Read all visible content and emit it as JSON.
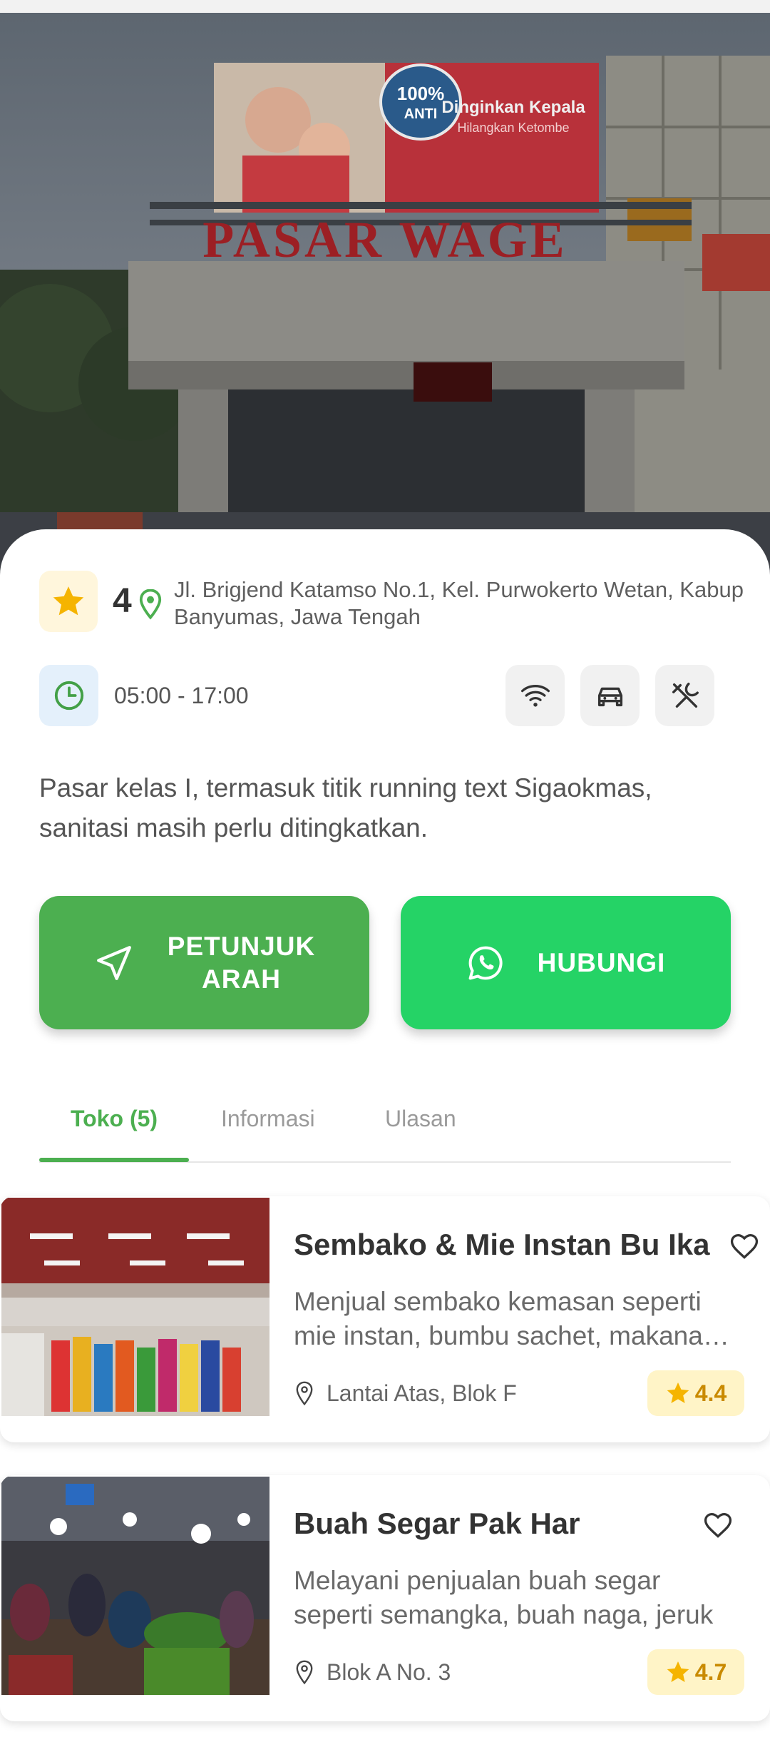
{
  "hero": {
    "billboard_line1": "Dinginkan Kepala",
    "billboard_line2": "Hilangkan Ketombe",
    "billboard_badge_1": "100%",
    "billboard_badge_2": "ANTI",
    "sign_text": "PASAR WAGE"
  },
  "place": {
    "rating": "4",
    "address": "Jl. Brigjend Katamso No.1, Kel. Purwokerto Wetan, Kabup\nBanyumas, Jawa Tengah",
    "hours": "05:00 - 17:00",
    "facilities": [
      "wifi-icon",
      "car-icon",
      "utensils-icon"
    ],
    "description": "Pasar kelas I, termasuk titik running text Sigaokmas, sanitasi masih perlu ditingkatkan."
  },
  "actions": {
    "directions_line1": "PETUNJUK",
    "directions_line2": "ARAH",
    "contact_label": "HUBUNGI"
  },
  "tabs": [
    {
      "label": "Toko (5)",
      "active": true
    },
    {
      "label": "Informasi",
      "active": false
    },
    {
      "label": "Ulasan",
      "active": false
    }
  ],
  "shops": [
    {
      "name": "Sembako & Mie Instan Bu Ika",
      "desc_line1": "Menjual sembako kemasan seperti",
      "desc_line2": "mie instan, bumbu sachet, makanan ringan",
      "location": "Lantai Atas, Blok F",
      "rating": "4.4"
    },
    {
      "name": "Buah Segar Pak Har",
      "desc_line1": "Melayani penjualan buah segar",
      "desc_line2": "seperti semangka, buah naga, jeruk",
      "location": "Blok A No. 3",
      "rating": "4.7"
    }
  ],
  "colors": {
    "primary_green": "#4caf50",
    "whatsapp_green": "#25d366",
    "star_yellow": "#f5b400"
  }
}
